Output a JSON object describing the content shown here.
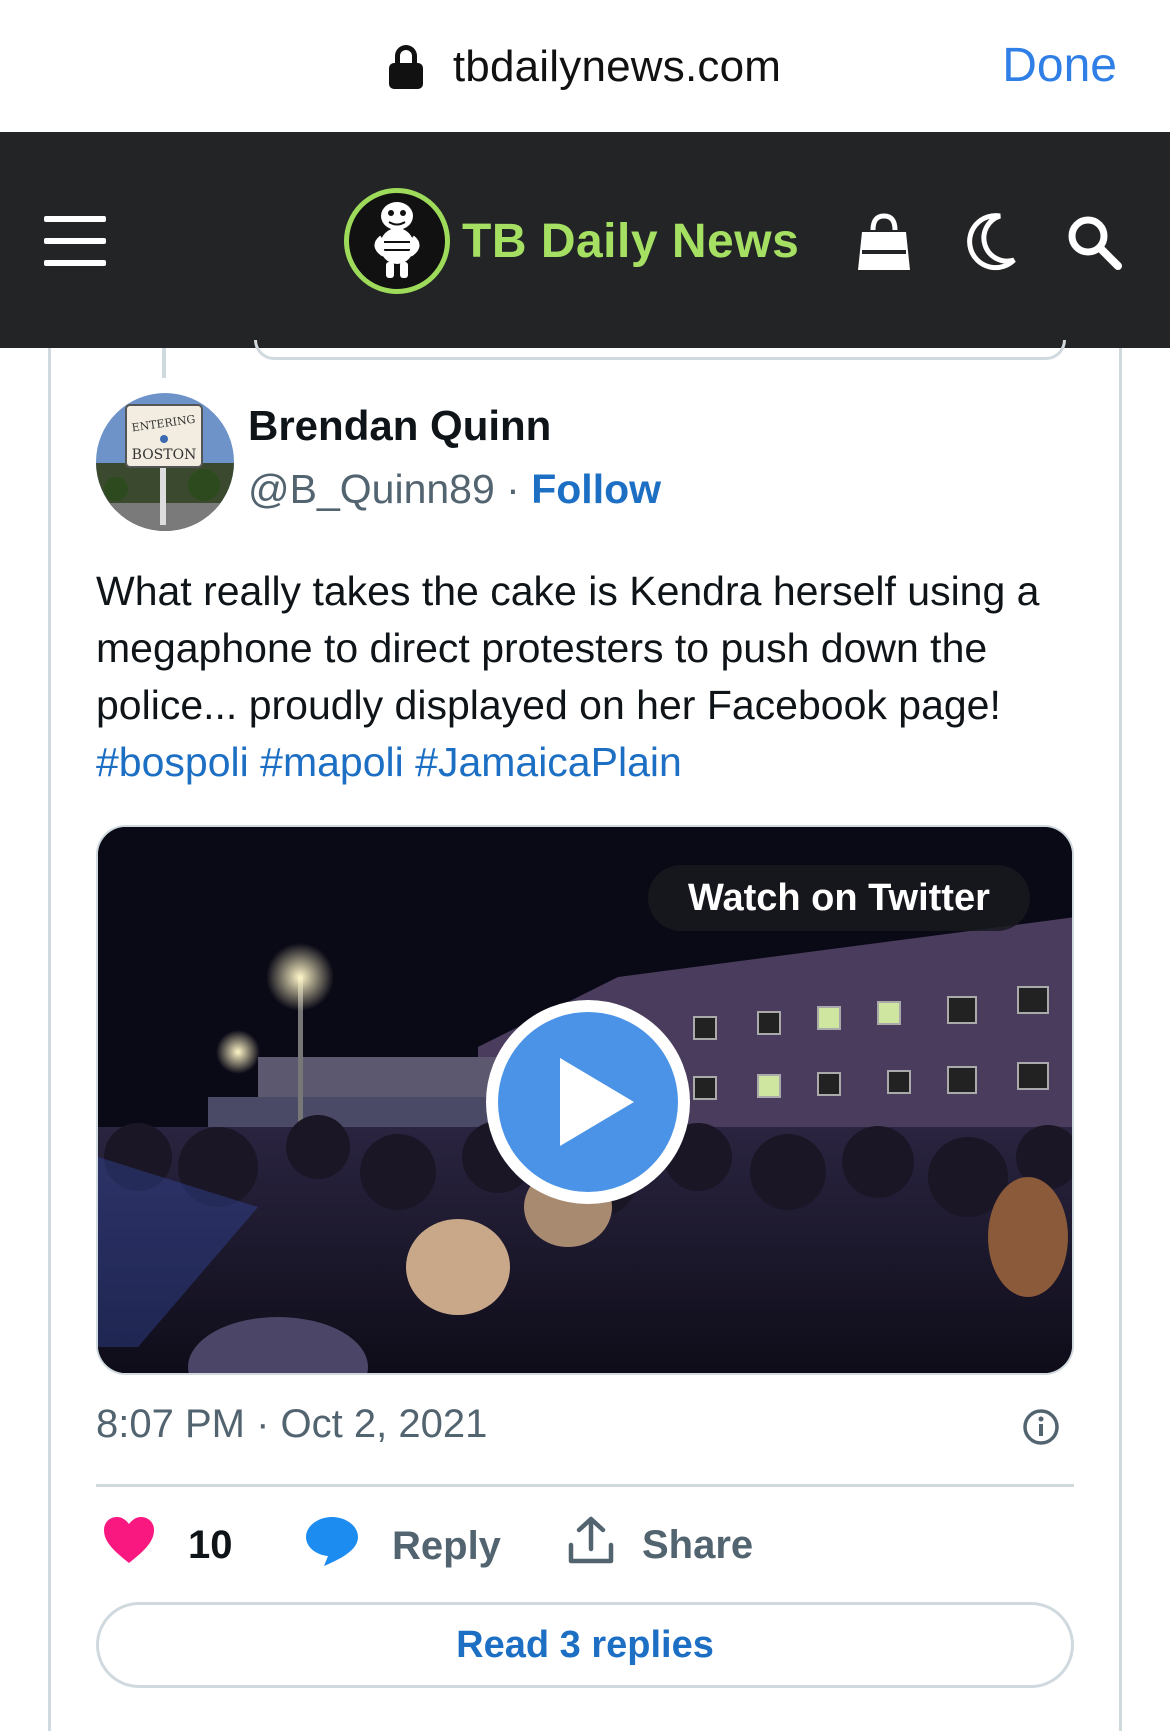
{
  "browser": {
    "url": "tbdailynews.com",
    "done_label": "Done"
  },
  "site": {
    "name": "TB Daily News",
    "brand_color": "#a6e063",
    "header_bg": "#222426",
    "icons": [
      "menu-icon",
      "bag-icon",
      "moon-icon",
      "search-icon"
    ]
  },
  "tweet": {
    "author_name": "Brendan Quinn",
    "author_handle": "@B_Quinn89",
    "separator": " · ",
    "follow_label": "Follow",
    "avatar_sign_lines": [
      "ENTERING",
      "BOSTON"
    ],
    "text_body": "What really takes the cake is Kendra herself using a megaphone to direct protesters to push down the police... proudly displayed on her Facebook page! ",
    "hashtags": [
      "#bospoli",
      "#mapoli",
      "#JamaicaPlain"
    ],
    "media": {
      "watch_label": "Watch on Twitter"
    },
    "timestamp": "8:07 PM · Oct 2, 2021",
    "likes": "10",
    "reply_label": "Reply",
    "share_label": "Share",
    "read_replies_label": "Read 3 replies",
    "link_color": "#1d6fc4",
    "like_color": "#f91880"
  }
}
